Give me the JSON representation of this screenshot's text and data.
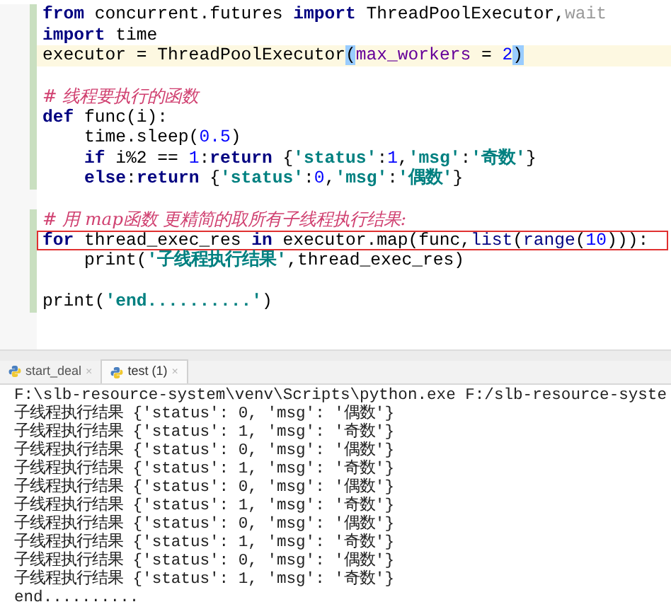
{
  "editor": {
    "lines": [
      {
        "changed": true,
        "current": false,
        "boxed": false,
        "tokens": [
          {
            "text": "from",
            "kind": "kw"
          },
          {
            "text": " concurrent.futures ",
            "kind": "plain"
          },
          {
            "text": "import",
            "kind": "kw"
          },
          {
            "text": " ThreadPoolExecutor,",
            "kind": "plain"
          },
          {
            "text": "wait",
            "kind": "unused"
          }
        ]
      },
      {
        "changed": true,
        "current": false,
        "boxed": false,
        "tokens": [
          {
            "text": "import",
            "kind": "kw"
          },
          {
            "text": " time",
            "kind": "plain"
          }
        ]
      },
      {
        "changed": true,
        "current": true,
        "boxed": false,
        "tokens": [
          {
            "text": "executor = ThreadPoolExecutor",
            "kind": "plain"
          },
          {
            "text": "(",
            "kind": "match"
          },
          {
            "text": "max_workers",
            "kind": "param"
          },
          {
            "text": " = ",
            "kind": "plain"
          },
          {
            "text": "2",
            "kind": "num"
          },
          {
            "text": ")",
            "kind": "match"
          }
        ]
      },
      {
        "changed": true,
        "current": false,
        "boxed": false
      },
      {
        "changed": true,
        "current": false,
        "boxed": false,
        "tokens": [
          {
            "text": "# 线程要执行的函数",
            "kind": "comment"
          }
        ]
      },
      {
        "changed": true,
        "current": false,
        "boxed": false,
        "tokens": [
          {
            "text": "def",
            "kind": "kw"
          },
          {
            "text": " func(i):",
            "kind": "plain"
          }
        ]
      },
      {
        "changed": true,
        "current": false,
        "boxed": false,
        "tokens": [
          {
            "text": "    time.sleep(",
            "kind": "plain"
          },
          {
            "text": "0.5",
            "kind": "num"
          },
          {
            "text": ")",
            "kind": "plain"
          }
        ]
      },
      {
        "changed": true,
        "current": false,
        "boxed": false,
        "tokens": [
          {
            "text": "    if",
            "kind": "kw"
          },
          {
            "text": " i%2 == ",
            "kind": "plain"
          },
          {
            "text": "1",
            "kind": "num"
          },
          {
            "text": ":",
            "kind": "plain"
          },
          {
            "text": "return",
            "kind": "kw"
          },
          {
            "text": " {",
            "kind": "plain"
          },
          {
            "text": "'status'",
            "kind": "str"
          },
          {
            "text": ":",
            "kind": "plain"
          },
          {
            "text": "1",
            "kind": "num"
          },
          {
            "text": ",",
            "kind": "plain"
          },
          {
            "text": "'msg'",
            "kind": "str"
          },
          {
            "text": ":",
            "kind": "plain"
          },
          {
            "text": "'奇数'",
            "kind": "str"
          },
          {
            "text": "}",
            "kind": "plain"
          }
        ]
      },
      {
        "changed": true,
        "current": false,
        "boxed": false,
        "tokens": [
          {
            "text": "    else",
            "kind": "kw"
          },
          {
            "text": ":",
            "kind": "plain"
          },
          {
            "text": "return",
            "kind": "kw"
          },
          {
            "text": " {",
            "kind": "plain"
          },
          {
            "text": "'status'",
            "kind": "str"
          },
          {
            "text": ":",
            "kind": "plain"
          },
          {
            "text": "0",
            "kind": "num"
          },
          {
            "text": ",",
            "kind": "plain"
          },
          {
            "text": "'msg'",
            "kind": "str"
          },
          {
            "text": ":",
            "kind": "plain"
          },
          {
            "text": "'偶数'",
            "kind": "str"
          },
          {
            "text": "}",
            "kind": "plain"
          }
        ]
      },
      {
        "changed": false,
        "current": false,
        "boxed": false
      },
      {
        "changed": true,
        "current": false,
        "boxed": false,
        "tokens": [
          {
            "text": "# 用 map函数 更精简的取所有子线程执行结果:",
            "kind": "comment"
          }
        ]
      },
      {
        "changed": true,
        "current": false,
        "boxed": true,
        "tokens": [
          {
            "text": "for",
            "kind": "kw"
          },
          {
            "text": " thread_exec_res ",
            "kind": "plain"
          },
          {
            "text": "in",
            "kind": "kw"
          },
          {
            "text": " executor.map(func,",
            "kind": "plain"
          },
          {
            "text": "list",
            "kind": "builtin"
          },
          {
            "text": "(",
            "kind": "plain"
          },
          {
            "text": "range",
            "kind": "builtin"
          },
          {
            "text": "(",
            "kind": "plain"
          },
          {
            "text": "10",
            "kind": "num"
          },
          {
            "text": "))):",
            "kind": "plain"
          }
        ]
      },
      {
        "changed": true,
        "current": false,
        "boxed": false,
        "tokens": [
          {
            "text": "    print(",
            "kind": "plain"
          },
          {
            "text": "'子线程执行结果'",
            "kind": "str"
          },
          {
            "text": ",thread_exec_res)",
            "kind": "plain"
          }
        ]
      },
      {
        "changed": true,
        "current": false,
        "boxed": false
      },
      {
        "changed": true,
        "current": false,
        "boxed": false,
        "tokens": [
          {
            "text": "print(",
            "kind": "plain"
          },
          {
            "text": "'end..........'",
            "kind": "str"
          },
          {
            "text": ")",
            "kind": "plain"
          }
        ]
      }
    ]
  },
  "run_tabs": [
    {
      "label": "start_deal",
      "selected": false,
      "close": "×"
    },
    {
      "label": "test (1)",
      "selected": true,
      "close": "×"
    }
  ],
  "console": {
    "lines": [
      "F:\\slb-resource-system\\venv\\Scripts\\python.exe F:/slb-resource-syste",
      "子线程执行结果 {'status': 0, 'msg': '偶数'}",
      "子线程执行结果 {'status': 1, 'msg': '奇数'}",
      "子线程执行结果 {'status': 0, 'msg': '偶数'}",
      "子线程执行结果 {'status': 1, 'msg': '奇数'}",
      "子线程执行结果 {'status': 0, 'msg': '偶数'}",
      "子线程执行结果 {'status': 1, 'msg': '奇数'}",
      "子线程执行结果 {'status': 0, 'msg': '偶数'}",
      "子线程执行结果 {'status': 1, 'msg': '奇数'}",
      "子线程执行结果 {'status': 0, 'msg': '偶数'}",
      "子线程执行结果 {'status': 1, 'msg': '奇数'}",
      "end.........."
    ]
  }
}
